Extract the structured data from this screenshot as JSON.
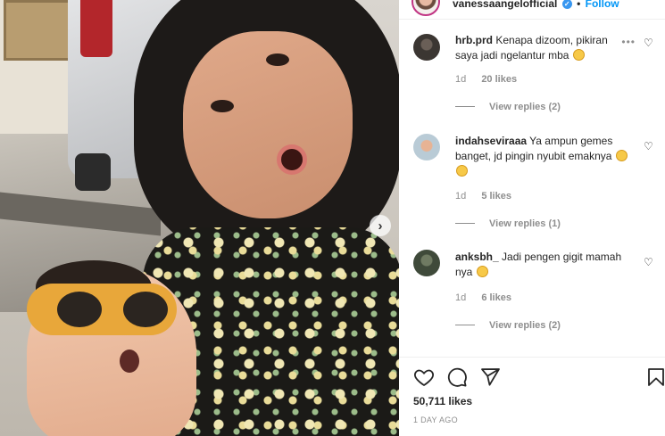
{
  "post": {
    "username": "vanessaangelofficial",
    "verified": true,
    "follow_label": "Follow",
    "likes": "50,711 likes",
    "date": "1 DAY AGO"
  },
  "photo": {
    "next_label": "›"
  },
  "comments": [
    {
      "username": "hrb.prd",
      "text": "Kenapa dizoom, pikiran saya jadi ngelantur mba",
      "emoji_count": 1,
      "time": "1d",
      "likes": "20 likes",
      "replies": "View replies (2)",
      "avatar_color": "#3b3632"
    },
    {
      "username": "indahseviraaa",
      "text": "Ya ampun gemes banget, jd pingin nyubit emaknya",
      "emoji_count": 2,
      "time": "1d",
      "likes": "5 likes",
      "replies": "View replies (1)",
      "avatar_color": "#b9cbd6"
    },
    {
      "username": "anksbh_",
      "text": "Jadi pengen gigit mamah nya",
      "emoji_count": 1,
      "time": "1d",
      "likes": "6 likes",
      "replies": "View replies (2)",
      "avatar_color": "#3f4a3a"
    }
  ],
  "icons": {
    "like": "heart-icon",
    "comment": "comment-icon",
    "share": "share-icon",
    "save": "bookmark-icon",
    "more": "more-icon",
    "verified": "verified-badge-icon"
  },
  "colors": {
    "follow": "#0095f6",
    "verified": "#3897f0",
    "meta": "#8e8e8e"
  }
}
